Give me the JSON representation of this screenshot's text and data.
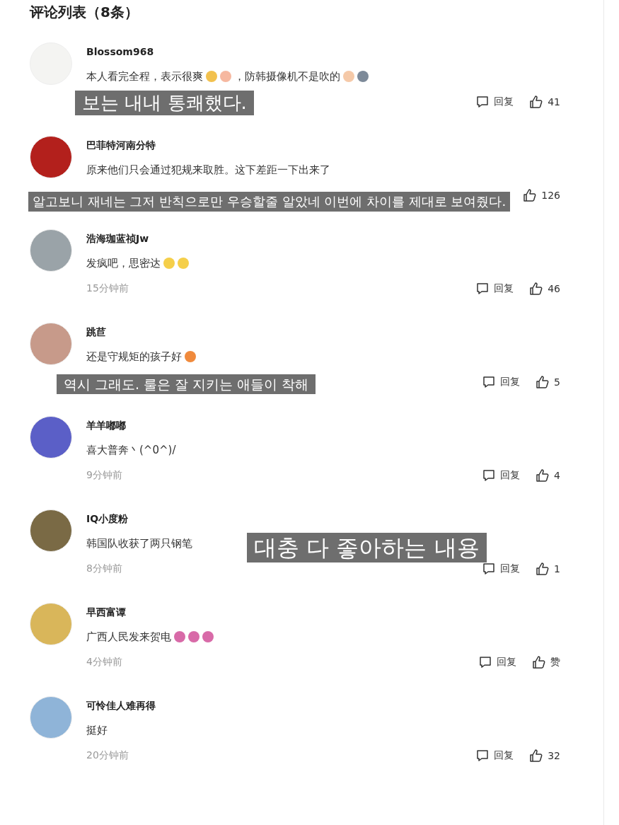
{
  "title": "评论列表（8条）",
  "comments": [
    {
      "user": "Blossom968",
      "color": "#f4f4f2",
      "content": [
        {
          "kind": "text",
          "text": "本人看完全程，表示很爽"
        },
        {
          "kind": "emoji",
          "color": "#f2c14e"
        },
        {
          "kind": "emoji",
          "color": "#f6b8a0"
        },
        {
          "kind": "text",
          "text": "，防韩摄像机不是吹的"
        },
        {
          "kind": "emoji",
          "color": "#f5c9a8"
        },
        {
          "kind": "emoji",
          "color": "#7d8a99"
        }
      ],
      "reply": "回复",
      "likes": "41",
      "caption": "보는 내내 통쾌했다."
    },
    {
      "user": "巴菲特河南分特",
      "color": "#b3201c",
      "content": [
        {
          "kind": "text",
          "text": "原来他们只会通过犯规来取胜。这下差距一下出来了"
        }
      ],
      "likes": "126",
      "caption": "알고보니 재네는 그저 반칙으로만 우승할줄 알았네 이번에 차이를 제대로 보여줬다."
    },
    {
      "user": "浩海珈蓝祯Jw",
      "color": "#9aa3a8",
      "content": [
        {
          "kind": "text",
          "text": "发疯吧，思密达"
        },
        {
          "kind": "emoji",
          "color": "#f5cf4a"
        },
        {
          "kind": "emoji",
          "color": "#f5cf4a"
        }
      ],
      "time": "15分钟前",
      "reply": "回复",
      "likes": "46"
    },
    {
      "user": "跳苣",
      "color": "#c79a8a",
      "content": [
        {
          "kind": "text",
          "text": "还是守规矩的孩子好"
        },
        {
          "kind": "emoji",
          "color": "#f08a3c"
        }
      ],
      "reply": "回复",
      "likes": "5",
      "caption": "역시 그래도. 룰은 잘 지키는 애들이 착해"
    },
    {
      "user": "羊羊嘟嘟",
      "color": "#5b5fc7",
      "content": [
        {
          "kind": "text",
          "text": "喜大普奔丶(^0^)/"
        }
      ],
      "time": "9分钟前",
      "reply": "回复",
      "likes": "4"
    },
    {
      "user": "IQ小度粉",
      "color": "#7a6a45",
      "content": [
        {
          "kind": "text",
          "text": "韩国队收获了两只钢笔"
        }
      ],
      "time": "8分钟前",
      "reply": "回复",
      "likes": "1",
      "caption": "대충 다 좋아하는 내용"
    },
    {
      "user": "早西富谭",
      "color": "#d9b65a",
      "content": [
        {
          "kind": "text",
          "text": "广西人民发来贺电"
        },
        {
          "kind": "emoji",
          "color": "#d86aa8"
        },
        {
          "kind": "emoji",
          "color": "#d86aa8"
        },
        {
          "kind": "emoji",
          "color": "#d86aa8"
        }
      ],
      "time": "4分钟前",
      "reply": "回复",
      "likes": "赞"
    },
    {
      "user": "可怜佳人难再得",
      "color": "#8fb4d8",
      "content": [
        {
          "kind": "text",
          "text": "挺好"
        }
      ],
      "time": "20分钟前",
      "reply": "回复",
      "likes": "32"
    }
  ]
}
